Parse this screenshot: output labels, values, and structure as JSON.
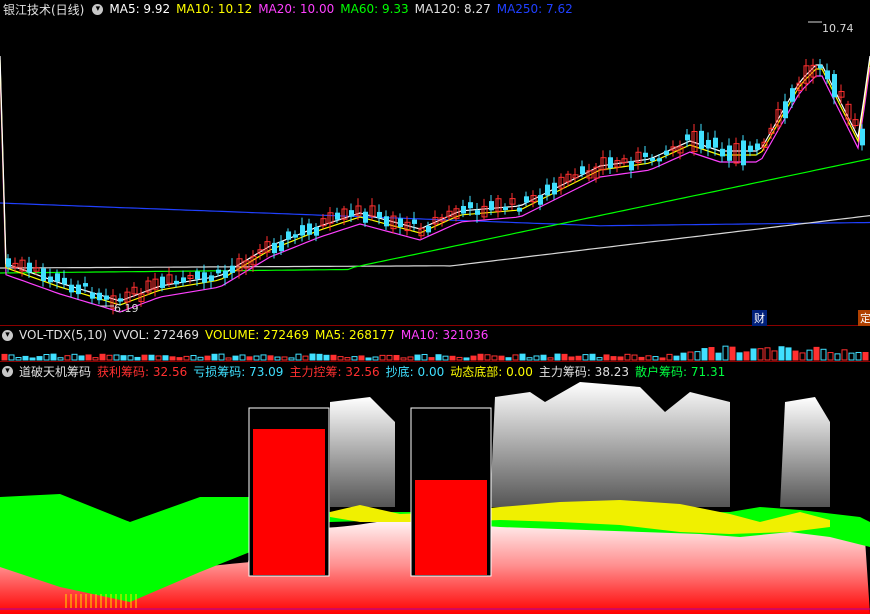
{
  "main": {
    "title": "银江技术(日线)",
    "ma": [
      {
        "label": "MA5: 9.92",
        "color": "#ffffff"
      },
      {
        "label": "MA10: 10.12",
        "color": "#ffff00"
      },
      {
        "label": "MA20: 10.00",
        "color": "#ff40ff"
      },
      {
        "label": "MA60: 9.33",
        "color": "#00ff00"
      },
      {
        "label": "MA120: 8.27",
        "color": "#e0e0e0"
      },
      {
        "label": "MA250: 7.62",
        "color": "#2040ff"
      }
    ],
    "high_label": "10.74",
    "low_label": "6.19",
    "tag_cai": "财",
    "tag_ding": "定"
  },
  "volume": {
    "title": "VOL-TDX(5,10)",
    "items": [
      {
        "label": "VVOL: 272469",
        "color": "#e0e0e0"
      },
      {
        "label": "VOLUME: 272469",
        "color": "#ffff00"
      },
      {
        "label": "MA5: 268177",
        "color": "#ffff00"
      },
      {
        "label": "MA10: 321036",
        "color": "#ff40ff"
      }
    ]
  },
  "chips": {
    "title": "道破天机筹码",
    "items": [
      {
        "label": "获利筹码: 32.56",
        "color": "#ff3030"
      },
      {
        "label": "亏损筹码: 73.09",
        "color": "#40e0ff"
      },
      {
        "label": "主力控筹: 32.56",
        "color": "#ff3030"
      },
      {
        "label": "抄底: 0.00",
        "color": "#40e0ff"
      },
      {
        "label": "动态底部: 0.00",
        "color": "#ffff00"
      },
      {
        "label": "主力筹码: 38.23",
        "color": "#e0e0e0"
      },
      {
        "label": "散户筹码: 71.31",
        "color": "#00ff40"
      }
    ]
  }
}
